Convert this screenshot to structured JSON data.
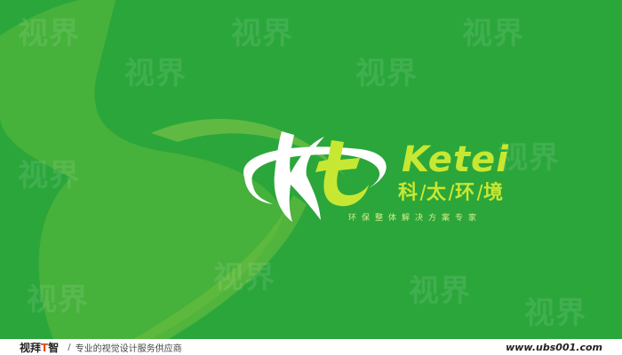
{
  "logo": {
    "name": "Ketei",
    "chinese_chars": [
      "科",
      "太",
      "环",
      "境"
    ],
    "tagline": "环保整体解决方案专家",
    "colors": {
      "background": "#2ba63b",
      "accent": "#c7e832",
      "white": "#ffffff"
    }
  },
  "watermark": {
    "text": "视界"
  },
  "footer": {
    "brand_prefix": "视",
    "brand_mid": "拜",
    "brand_accent": "T",
    "brand_suffix": "智",
    "separator": "/",
    "slogan": "专业的视觉设计服务供应商",
    "url": "www.ubs001.com"
  }
}
